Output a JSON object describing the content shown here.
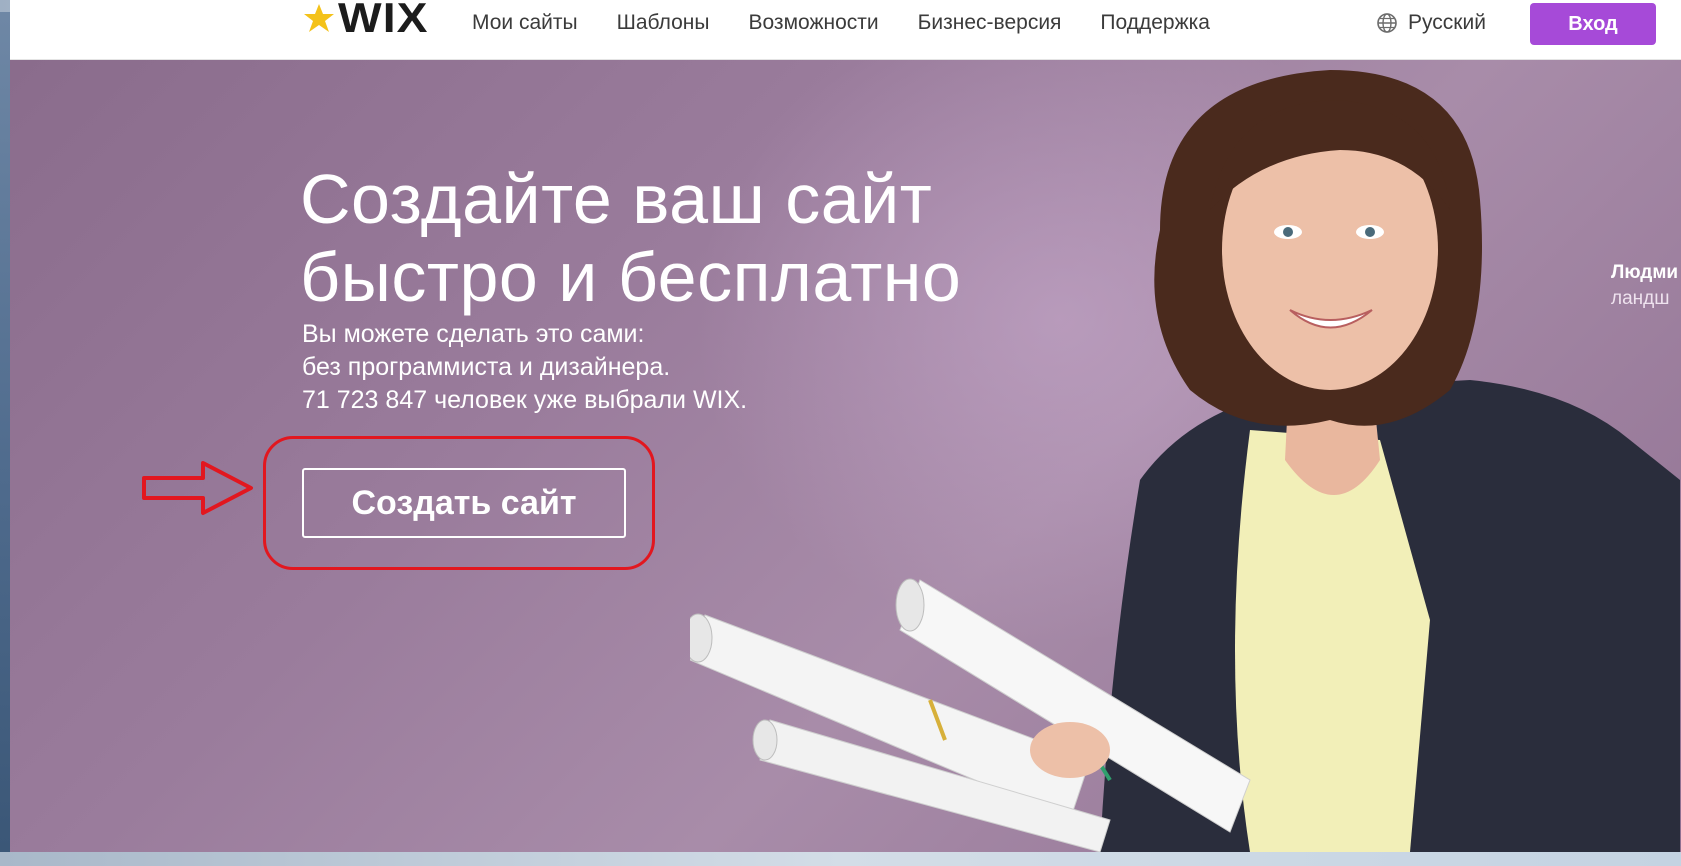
{
  "header": {
    "logo_text": "WIX",
    "nav": [
      "Мои сайты",
      "Шаблоны",
      "Возможности",
      "Бизнес-версия",
      "Поддержка"
    ],
    "language": "Русский",
    "login_label": "Вход"
  },
  "hero": {
    "title_line1": "Создайте ваш сайт",
    "title_line2": "быстро и бесплатно",
    "sub_line1": "Вы можете сделать это сами:",
    "sub_line2": "без программиста и дизайнера.",
    "sub_line3": "71 723 847 человек уже выбрали WIX.",
    "cta_label": "Создать сайт",
    "testimonial_name": "Людми",
    "testimonial_role": "ландш"
  },
  "colors": {
    "accent": "#a64ad8",
    "hero_background": "#9a7c9c",
    "annotation": "#e2171f"
  },
  "icons": {
    "logo": "wix-star-logo-icon",
    "language": "globe-icon",
    "annotation": "red-arrow-icon"
  }
}
